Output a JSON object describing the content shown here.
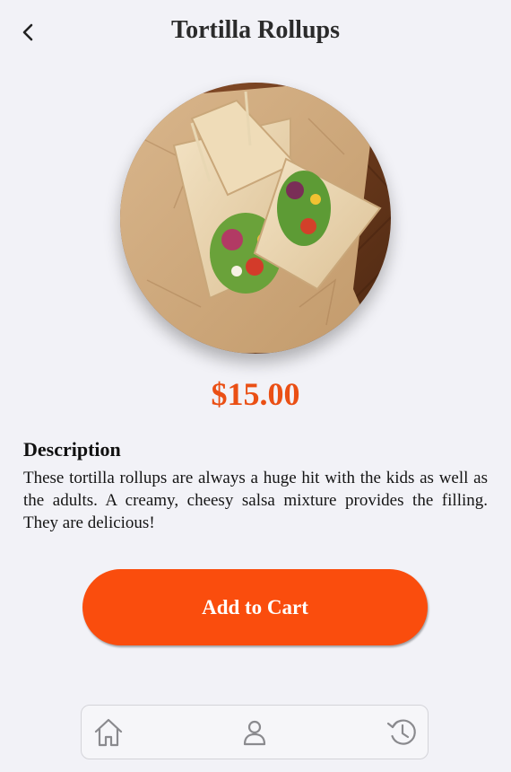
{
  "header": {
    "title": "Tortilla Rollups",
    "back_icon": "chevron-left-icon"
  },
  "product": {
    "image_alt": "Tortilla Rollups",
    "price": "$15.00",
    "accent_color": "#ea4f14"
  },
  "description": {
    "heading": "Description",
    "text": "These tortilla rollups are always a huge hit with the kids as well as the adults. A creamy, cheesy salsa mixture provides the filling. They are delicious!"
  },
  "actions": {
    "add_to_cart_label": "Add to Cart",
    "button_color": "#fa4d0d"
  },
  "bottom_nav": {
    "items": [
      {
        "icon": "home-icon"
      },
      {
        "icon": "user-icon"
      },
      {
        "icon": "history-icon"
      }
    ]
  }
}
